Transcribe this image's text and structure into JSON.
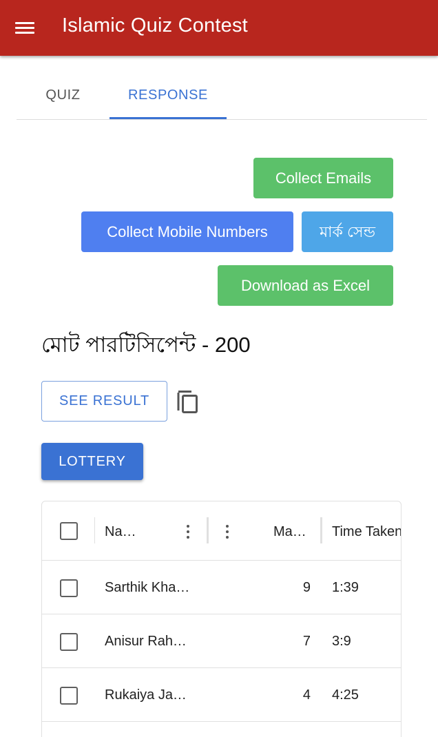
{
  "app": {
    "title": "Islamic Quiz Contest",
    "menu_icon": "menu-icon",
    "bar_color": "#b8261e"
  },
  "tabs": [
    {
      "label": "QUIZ",
      "active": false
    },
    {
      "label": "RESPONSE",
      "active": true
    }
  ],
  "actions": {
    "collect_emails": "Collect Emails",
    "collect_mobile": "Collect Mobile Numbers",
    "mark_send": "মার্ক সেন্ড",
    "download_excel": "Download as Excel"
  },
  "summary": {
    "total_participants": "মোট পারটিসিপেন্ট - 200"
  },
  "see_result": "SEE RESULT",
  "copy_icon": "copy-icon",
  "lottery": "LOTTERY",
  "table": {
    "columns": [
      "Na…",
      "Ma…",
      "Time Taken"
    ],
    "rows": [
      {
        "name": "Sarthik Kha…",
        "marks": "9",
        "time": "1:39"
      },
      {
        "name": "Anisur Rah…",
        "marks": "7",
        "time": "3:9"
      },
      {
        "name": "Rukaiya Ja…",
        "marks": "4",
        "time": "4:25"
      }
    ]
  },
  "colors": {
    "accent": "#3a72d3",
    "green": "#5cc16a",
    "blue": "#4f7ff0",
    "light_blue": "#4ea6e8"
  }
}
